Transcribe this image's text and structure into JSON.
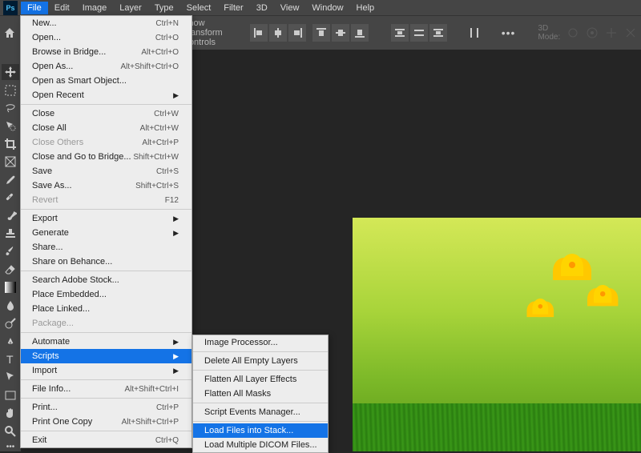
{
  "menubar": {
    "items": [
      "File",
      "Edit",
      "Image",
      "Layer",
      "Type",
      "Select",
      "Filter",
      "3D",
      "View",
      "Window",
      "Help"
    ],
    "active_index": 0,
    "logo": "Ps"
  },
  "options_bar": {
    "show_transform": "Show Transform Controls",
    "mode3d": "3D Mode:"
  },
  "file_menu": {
    "groups": [
      [
        {
          "label": "New...",
          "shortcut": "Ctrl+N"
        },
        {
          "label": "Open...",
          "shortcut": "Ctrl+O"
        },
        {
          "label": "Browse in Bridge...",
          "shortcut": "Alt+Ctrl+O"
        },
        {
          "label": "Open As...",
          "shortcut": "Alt+Shift+Ctrl+O"
        },
        {
          "label": "Open as Smart Object..."
        },
        {
          "label": "Open Recent",
          "submenu": true
        }
      ],
      [
        {
          "label": "Close",
          "shortcut": "Ctrl+W"
        },
        {
          "label": "Close All",
          "shortcut": "Alt+Ctrl+W"
        },
        {
          "label": "Close Others",
          "shortcut": "Alt+Ctrl+P",
          "disabled": true
        },
        {
          "label": "Close and Go to Bridge...",
          "shortcut": "Shift+Ctrl+W"
        },
        {
          "label": "Save",
          "shortcut": "Ctrl+S"
        },
        {
          "label": "Save As...",
          "shortcut": "Shift+Ctrl+S"
        },
        {
          "label": "Revert",
          "shortcut": "F12",
          "disabled": true
        }
      ],
      [
        {
          "label": "Export",
          "submenu": true
        },
        {
          "label": "Generate",
          "submenu": true
        },
        {
          "label": "Share..."
        },
        {
          "label": "Share on Behance..."
        }
      ],
      [
        {
          "label": "Search Adobe Stock..."
        },
        {
          "label": "Place Embedded..."
        },
        {
          "label": "Place Linked..."
        },
        {
          "label": "Package...",
          "disabled": true
        }
      ],
      [
        {
          "label": "Automate",
          "submenu": true
        },
        {
          "label": "Scripts",
          "submenu": true,
          "highlight": true
        },
        {
          "label": "Import",
          "submenu": true
        }
      ],
      [
        {
          "label": "File Info...",
          "shortcut": "Alt+Shift+Ctrl+I"
        }
      ],
      [
        {
          "label": "Print...",
          "shortcut": "Ctrl+P"
        },
        {
          "label": "Print One Copy",
          "shortcut": "Alt+Shift+Ctrl+P"
        }
      ],
      [
        {
          "label": "Exit",
          "shortcut": "Ctrl+Q"
        }
      ]
    ]
  },
  "scripts_menu": {
    "groups": [
      [
        {
          "label": "Image Processor..."
        }
      ],
      [
        {
          "label": "Delete All Empty Layers"
        }
      ],
      [
        {
          "label": "Flatten All Layer Effects"
        },
        {
          "label": "Flatten All Masks"
        }
      ],
      [
        {
          "label": "Script Events Manager..."
        }
      ],
      [
        {
          "label": "Load Files into Stack...",
          "highlight": true
        },
        {
          "label": "Load Multiple DICOM Files...",
          "clipped": true
        }
      ]
    ]
  }
}
